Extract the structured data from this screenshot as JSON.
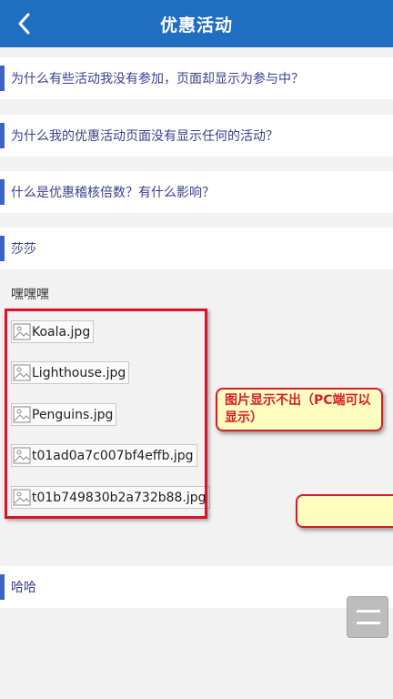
{
  "header": {
    "title": "优惠活动",
    "back_icon": "back-chevron-icon"
  },
  "questions": [
    {
      "text": "为什么有些活动我没有参加，页面却显示为参与中？"
    },
    {
      "text": "为什么我的优惠活动页面没有显示任何的活动？"
    },
    {
      "text": "什么是优惠稽核倍数？有什么影响？"
    },
    {
      "text": "莎莎"
    },
    {
      "text": "哈哈"
    }
  ],
  "answer": {
    "title": "嘿嘿嘿",
    "images": [
      {
        "filename": "Koala.jpg",
        "icon": "broken-image-icon"
      },
      {
        "filename": "Lighthouse.jpg",
        "icon": "broken-image-icon"
      },
      {
        "filename": "Penguins.jpg",
        "icon": "broken-image-icon"
      },
      {
        "filename": "t01ad0a7c007bf4effb.jpg",
        "icon": "broken-image-icon"
      },
      {
        "filename": "t01b749830b2a732b88.jpg",
        "icon": "broken-image-icon"
      }
    ]
  },
  "annotation": {
    "text": "图片显示不出（PC端可以显示）"
  },
  "menu": {
    "icon": "hamburger-menu-icon"
  },
  "colors": {
    "header_bg": "#1f6ec2",
    "accent_bar": "#3e63c8",
    "question_text": "#3a3f8c",
    "annotation_red": "#d4152a",
    "callout_bg": "#fffdc0"
  }
}
